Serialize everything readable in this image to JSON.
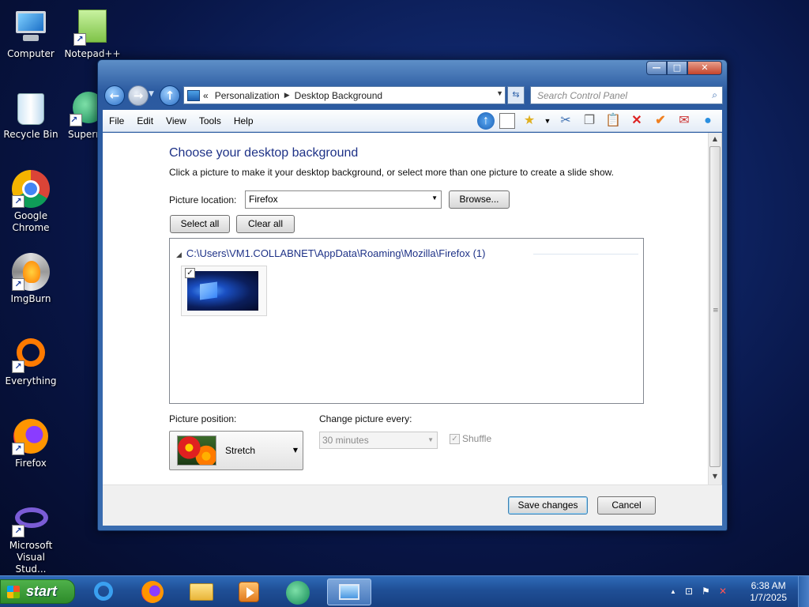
{
  "desktop": {
    "icons": [
      {
        "label": "Computer",
        "icon": "computer-icon"
      },
      {
        "label": "Notepad++",
        "icon": "notepad-plus-plus-icon"
      },
      {
        "label": "Recycle Bin",
        "icon": "recycle-bin-icon"
      },
      {
        "label": "Supern",
        "icon": "supernova-icon"
      },
      {
        "label": "Google Chrome",
        "icon": "chrome-icon"
      },
      {
        "label": "ImgBurn",
        "icon": "imgburn-icon"
      },
      {
        "label": "Everything",
        "icon": "everything-icon"
      },
      {
        "label": "Firefox",
        "icon": "firefox-icon"
      },
      {
        "label": "Microsoft Visual Stud...",
        "icon": "visual-studio-icon"
      }
    ]
  },
  "window": {
    "breadcrumb": {
      "overflow": "«",
      "items": [
        "Personalization",
        "Desktop Background"
      ]
    },
    "search_placeholder": "Search Control Panel",
    "caption_buttons": {
      "minimize": "—",
      "maximize": "□",
      "close": "✕"
    },
    "menu": [
      "File",
      "Edit",
      "View",
      "Tools",
      "Help"
    ],
    "toolbar_icons": [
      "up-arrow-icon",
      "panel-icon",
      "favorites-icon",
      "cut-icon",
      "copy-icon",
      "paste-icon",
      "delete-icon",
      "check-icon",
      "mail-icon",
      "chat-icon"
    ]
  },
  "main": {
    "heading": "Choose your desktop background",
    "subtext": "Click a picture to make it your desktop background, or select more than one picture to create a slide show.",
    "picture_location_label": "Picture location:",
    "picture_location_value": "Firefox",
    "browse_button": "Browse...",
    "select_all_button": "Select all",
    "clear_all_button": "Clear all",
    "group_title": "C:\\Users\\VM1.COLLABNET\\AppData\\Roaming\\Mozilla\\Firefox (1)",
    "thumbnails": [
      {
        "checked": true
      }
    ],
    "picture_position_label": "Picture position:",
    "picture_position_value": "Stretch",
    "change_picture_label": "Change picture every:",
    "change_picture_value": "30 minutes",
    "shuffle_label": "Shuffle",
    "shuffle_checked": true
  },
  "footer": {
    "save_button": "Save changes",
    "cancel_button": "Cancel"
  },
  "taskbar": {
    "start_label": "start",
    "apps": [
      "internet-explorer-icon",
      "firefox-icon",
      "file-explorer-icon",
      "media-player-icon",
      "browser-globe-icon",
      "control-panel-icon"
    ],
    "active_app": "control-panel-icon",
    "tray_icons": [
      "show-hidden-icon",
      "network-icon",
      "action-center-flag-icon",
      "volume-muted-icon"
    ],
    "time": "6:38 AM",
    "date": "1/7/2025"
  }
}
